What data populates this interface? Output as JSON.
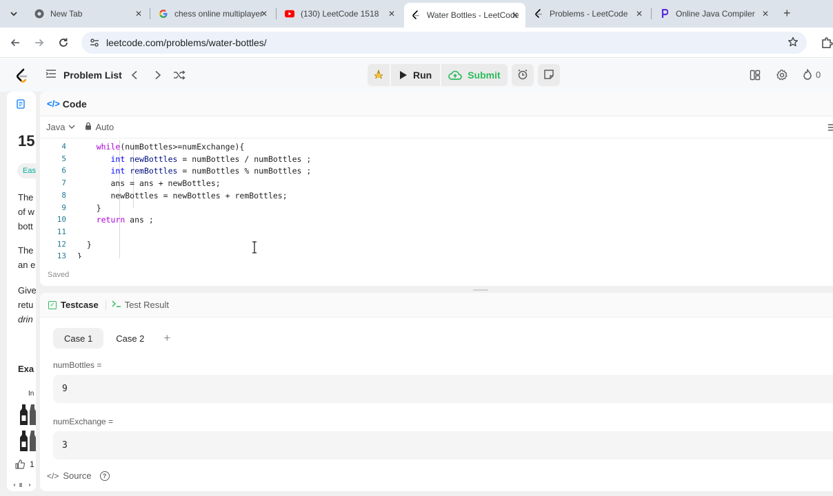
{
  "browser": {
    "tabs": [
      {
        "title": "New Tab",
        "icon": "chrome-icon"
      },
      {
        "title": "chess online multiplayer",
        "icon": "google-icon"
      },
      {
        "title": "(130) LeetCode 1518",
        "icon": "youtube-icon"
      },
      {
        "title": "Water Bottles - LeetCode",
        "icon": "leetcode-icon",
        "active": true
      },
      {
        "title": "Problems - LeetCode",
        "icon": "leetcode-icon"
      },
      {
        "title": "Online Java Compiler",
        "icon": "programiz-icon"
      }
    ],
    "close_glyph": "✕",
    "new_tab_glyph": "+",
    "url": "leetcode.com/problems/water-bottles/"
  },
  "header": {
    "problem_list": "Problem List",
    "run": "Run",
    "submit": "Submit",
    "streak_count": "0"
  },
  "left_panel": {
    "lines": [
      "15",
      "Eas",
      "The",
      "of w",
      "bott",
      "The",
      "an e",
      "Give",
      "retu",
      "drin",
      "Exa",
      "In",
      "1"
    ]
  },
  "editor": {
    "title": "Code",
    "language": "Java",
    "mode": "Auto",
    "status": "Saved",
    "lines": [
      {
        "n": "4",
        "html": "    <span class='kw'>while</span>(numBottles>=numExchange){"
      },
      {
        "n": "5",
        "html": "       <span class='ty'>int</span> <span class='vr'>newBottles</span> = numBottles / numBottles ;"
      },
      {
        "n": "6",
        "html": "       <span class='ty'>int</span> <span class='vr'>remBottles</span> = numBottles % numBottles ;"
      },
      {
        "n": "7",
        "html": "       ans = ans + newBottles;"
      },
      {
        "n": "8",
        "html": "       newBottles = newBottles + remBottles;"
      },
      {
        "n": "9",
        "html": "    }"
      },
      {
        "n": "10",
        "html": "    <span class='kw'>return</span> ans ;"
      },
      {
        "n": "11",
        "html": ""
      },
      {
        "n": "12",
        "html": "  }"
      },
      {
        "n": "13",
        "html": "}"
      }
    ]
  },
  "testcase": {
    "tab_label": "Testcase",
    "result_label": "Test Result",
    "cases": [
      "Case 1",
      "Case 2"
    ],
    "add_glyph": "+",
    "fields": [
      {
        "label": "numBottles =",
        "value": "9"
      },
      {
        "label": "numExchange =",
        "value": "3"
      }
    ],
    "source_label": "Source",
    "help_glyph": "?"
  }
}
